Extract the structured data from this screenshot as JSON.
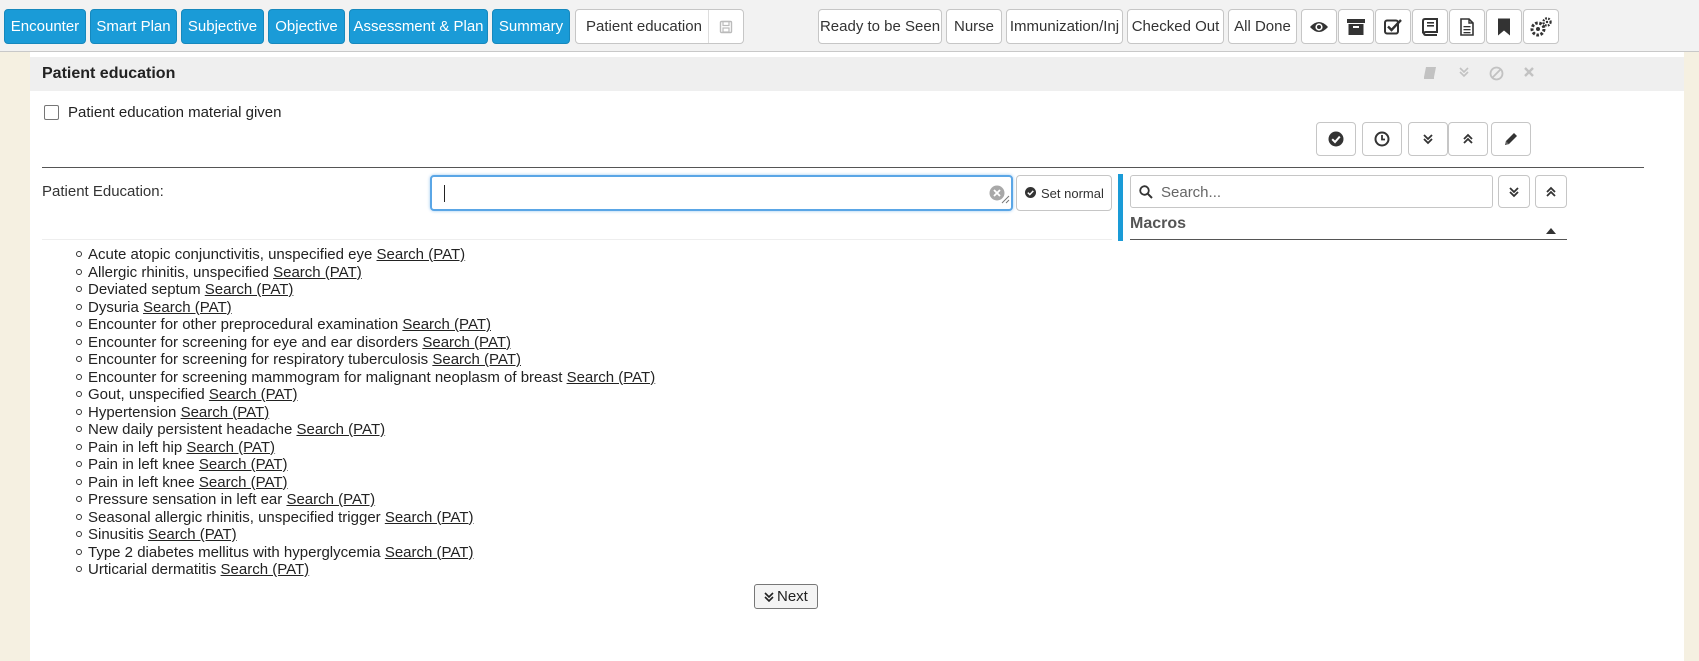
{
  "toolbar": {
    "tabs": [
      {
        "label": "Encounter",
        "name": "tab-encounter"
      },
      {
        "label": "Smart Plan",
        "name": "tab-smart-plan"
      },
      {
        "label": "Subjective",
        "name": "tab-subjective"
      },
      {
        "label": "Objective",
        "name": "tab-objective"
      },
      {
        "label": "Assessment & Plan",
        "name": "tab-assessment-plan"
      },
      {
        "label": "Summary",
        "name": "tab-summary"
      }
    ],
    "active_tab": "Patient education",
    "status_buttons": [
      "Ready to be Seen",
      "Nurse",
      "Immunization/Inj",
      "Checked Out",
      "All Done"
    ],
    "icons": [
      "eye-icon",
      "archive-icon",
      "checklist-icon",
      "book-icon",
      "document-icon",
      "bookmark-icon",
      "settings-icon"
    ],
    "accent_color": "#1a9bd7"
  },
  "section": {
    "title": "Patient education",
    "checkbox_label": "Patient education material given",
    "checkbox_checked": false,
    "field_label": "Patient Education:",
    "input_value": "",
    "set_normal_label": "Set normal"
  },
  "macros": {
    "search_placeholder": "Search...",
    "title": "Macros"
  },
  "diagnoses": [
    {
      "name": "Acute atopic conjunctivitis, unspecified eye",
      "link": "Search (PAT)"
    },
    {
      "name": "Allergic rhinitis, unspecified",
      "link": "Search (PAT)"
    },
    {
      "name": "Deviated septum",
      "link": "Search (PAT)"
    },
    {
      "name": "Dysuria",
      "link": "Search (PAT)"
    },
    {
      "name": "Encounter for other preprocedural examination",
      "link": "Search (PAT)"
    },
    {
      "name": "Encounter for screening for eye and ear disorders",
      "link": "Search (PAT)"
    },
    {
      "name": "Encounter for screening for respiratory tuberculosis",
      "link": "Search (PAT)"
    },
    {
      "name": "Encounter for screening mammogram for malignant neoplasm of breast",
      "link": "Search (PAT)"
    },
    {
      "name": "Gout, unspecified",
      "link": "Search (PAT)"
    },
    {
      "name": "Hypertension",
      "link": "Search (PAT)"
    },
    {
      "name": "New daily persistent headache",
      "link": "Search (PAT)"
    },
    {
      "name": "Pain in left hip",
      "link": "Search (PAT)"
    },
    {
      "name": "Pain in left knee",
      "link": "Search (PAT)"
    },
    {
      "name": "Pain in left knee",
      "link": "Search (PAT)"
    },
    {
      "name": "Pressure sensation in left ear",
      "link": "Search (PAT)"
    },
    {
      "name": "Seasonal allergic rhinitis, unspecified trigger",
      "link": "Search (PAT)"
    },
    {
      "name": "Sinusitis",
      "link": "Search (PAT)"
    },
    {
      "name": "Type 2 diabetes mellitus with hyperglycemia",
      "link": "Search (PAT)"
    },
    {
      "name": "Urticarial dermatitis",
      "link": "Search (PAT)"
    }
  ],
  "next_label": "Next"
}
